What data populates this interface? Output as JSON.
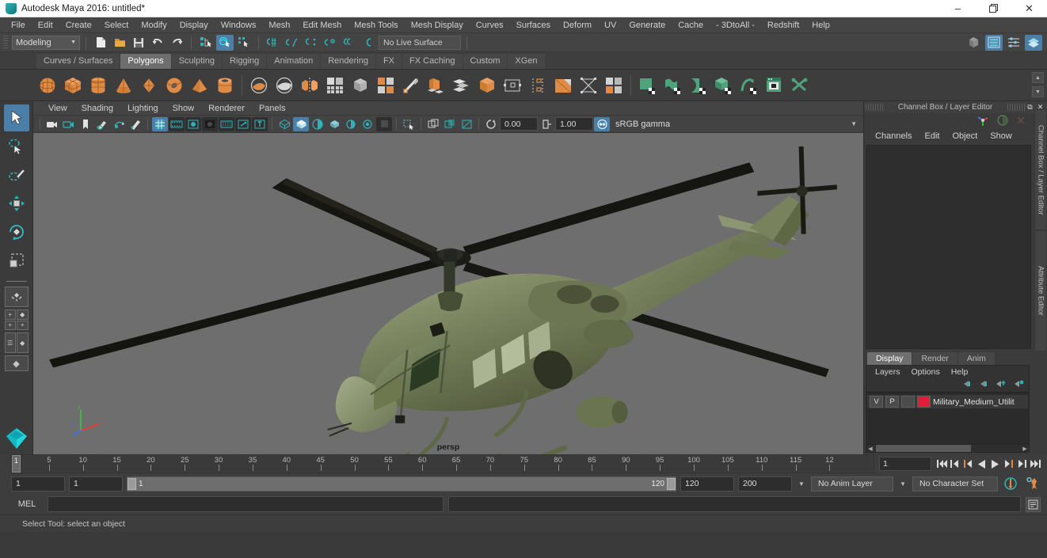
{
  "window": {
    "title": "Autodesk Maya 2016: untitled*",
    "app_icon": "maya-logo-icon",
    "minimize": "–",
    "maximize": "❐",
    "close": "✕"
  },
  "menubar": {
    "items": [
      "File",
      "Edit",
      "Create",
      "Select",
      "Modify",
      "Display",
      "Windows",
      "Mesh",
      "Edit Mesh",
      "Mesh Tools",
      "Mesh Display",
      "Curves",
      "Surfaces",
      "Deform",
      "UV",
      "Generate",
      "Cache",
      "- 3DtoAll -",
      "Redshift",
      "Help"
    ]
  },
  "status_row": {
    "mode_menu": "Modeling",
    "live_surface": "No Live Surface",
    "file_icons": [
      "new-scene-icon",
      "open-scene-icon",
      "save-scene-icon",
      "undo-icon",
      "redo-icon"
    ],
    "select_mask_icons": [
      "select-by-hierarchy-icon",
      "select-by-object-icon",
      "select-by-component-icon"
    ],
    "snap_icons": [
      "snap-to-grid-icon",
      "snap-to-curve-icon",
      "snap-to-point-icon",
      "snap-to-projected-center-icon",
      "snap-to-view-plane-icon",
      "make-live-icon"
    ],
    "right_icons": [
      "show-hide-modeling-toolkit-icon",
      "show-hide-attribute-editor-icon",
      "show-hide-tool-settings-icon",
      "show-hide-channel-box-icon"
    ]
  },
  "shelf": {
    "tabs": [
      "Curves / Surfaces",
      "Polygons",
      "Sculpting",
      "Rigging",
      "Animation",
      "Rendering",
      "FX",
      "FX Caching",
      "Custom",
      "XGen"
    ],
    "active_tab": "Polygons",
    "icons": [
      {
        "name": "poly-sphere-icon",
        "color": "#e08b45",
        "shape": "sphere"
      },
      {
        "name": "poly-cube-icon",
        "color": "#e08b45",
        "shape": "cube"
      },
      {
        "name": "poly-cylinder-icon",
        "color": "#e08b45",
        "shape": "cylinder"
      },
      {
        "name": "poly-cone-icon",
        "color": "#e08b45",
        "shape": "cone"
      },
      {
        "name": "poly-plane-icon",
        "color": "#e08b45",
        "shape": "diamond"
      },
      {
        "name": "poly-torus-icon",
        "color": "#e08b45",
        "shape": "torus"
      },
      {
        "name": "poly-pyramid-icon",
        "color": "#e08b45",
        "shape": "pyramid"
      },
      {
        "name": "poly-pipe-icon",
        "color": "#e08b45",
        "shape": "pipe"
      },
      {
        "name": "poly-booleans-union-icon",
        "color": "#cfcfcf",
        "shape": "bool1"
      },
      {
        "name": "poly-booleans-difference-icon",
        "color": "#cfcfcf",
        "shape": "bool2"
      },
      {
        "name": "poly-mirror-icon",
        "color": "#e08b45",
        "shape": "mirror"
      },
      {
        "name": "poly-smooth-icon",
        "color": "#cfcfcf",
        "shape": "grid"
      },
      {
        "name": "poly-combine-icon",
        "color": "#cfcfcf",
        "shape": "combine"
      },
      {
        "name": "poly-separate-icon",
        "color": "#cfcfcf",
        "shape": "separate"
      },
      {
        "name": "poly-multicut-icon",
        "color": "#cfcfcf",
        "shape": "knife"
      },
      {
        "name": "poly-extrude-icon",
        "color": "#e08b45",
        "shape": "extrude"
      },
      {
        "name": "poly-bevel-icon",
        "color": "#cfcfcf",
        "shape": "layers"
      },
      {
        "name": "poly-bridge-icon",
        "color": "#e08b45",
        "shape": "cubebig"
      },
      {
        "name": "poly-append-icon",
        "color": "#cfcfcf",
        "shape": "quadpts"
      },
      {
        "name": "poly-wedge-icon",
        "color": "#cfcfcf",
        "shape": "wedge"
      },
      {
        "name": "poly-fill-hole-icon",
        "color": "#e08b45",
        "shape": "fill"
      },
      {
        "name": "poly-reduce-icon",
        "color": "#cfcfcf",
        "shape": "reduce"
      },
      {
        "name": "poly-quadrangulate-icon",
        "color": "#cfcfcf",
        "shape": "quads"
      },
      {
        "name": "uv-editor-icon",
        "color": "#5aab85",
        "shape": "uvplane"
      },
      {
        "name": "uv-planar-map-icon",
        "color": "#5aab85",
        "shape": "uvcurve"
      },
      {
        "name": "uv-cylindrical-map-icon",
        "color": "#5aab85",
        "shape": "uvcurve2"
      },
      {
        "name": "uv-automatic-map-icon",
        "color": "#5aab85",
        "shape": "uvcube"
      },
      {
        "name": "uv-unfold-icon",
        "color": "#5aab85",
        "shape": "uvarrow"
      },
      {
        "name": "uv-texture-editor-icon",
        "color": "#5aab85",
        "shape": "uvwin"
      },
      {
        "name": "uv-cut-icon",
        "color": "#5aab85",
        "shape": "uvscissors"
      }
    ]
  },
  "left_toolbar": {
    "tools": [
      {
        "name": "select-tool",
        "active": true
      },
      {
        "name": "lasso-select-tool",
        "active": false
      },
      {
        "name": "paint-select-tool",
        "active": false
      },
      {
        "name": "move-tool",
        "active": false
      },
      {
        "name": "rotate-tool",
        "active": false
      },
      {
        "name": "scale-tool",
        "active": false
      }
    ],
    "layouts": [
      "single-perspective-layout",
      "four-view-layout",
      "outliner-persp-layout",
      "persp-graph-layout",
      "hypershade-layout"
    ]
  },
  "viewport": {
    "menus": [
      "View",
      "Shading",
      "Lighting",
      "Show",
      "Renderer",
      "Panels"
    ],
    "camera_label": "persp",
    "toolbar_left_icons": [
      "select-camera-icon",
      "camera-attributes-icon",
      "bookmark-icon",
      "image-plane-icon",
      "2d-pan-zoom-icon",
      "grease-pencil-icon"
    ],
    "toolbar_display_icons": [
      "grid-toggle-icon",
      "film-gate-icon",
      "resolution-gate-icon",
      "gate-mask-icon",
      "film-origin-icon",
      "exposure-icon",
      "field-chart-icon"
    ],
    "toolbar_shading_icons": [
      "wireframe-icon",
      "smooth-shade-icon",
      "shaded-wireframe-icon",
      "textured-icon",
      "lighting-icon",
      "shadows-icon",
      "ao-icon",
      "aa-icon"
    ],
    "toolbar_xray_icons": [
      "xray-icon",
      "xray-joints-icon",
      "xray-active-components-icon"
    ],
    "exposure_value": "0.00",
    "gamma_value": "1.00",
    "color_management": "sRGB gamma",
    "background_color": "#6e6e6e",
    "model_description": "olive-green military utility helicopter with main rotor and tail rotor"
  },
  "channel_box": {
    "panel_title": "Channel Box / Layer Editor",
    "menus": [
      "Channels",
      "Edit",
      "Object",
      "Show"
    ],
    "side_tabs": [
      "Channel Box / Layer Editor",
      "Attribute Editor"
    ],
    "float_icon": "undock-icon",
    "close_icon": "close-icon",
    "header_icons": [
      "manipulator-icon",
      "sphere-icon",
      "transform-icon"
    ]
  },
  "layer_editor": {
    "tabs": [
      "Display",
      "Render",
      "Anim"
    ],
    "active_tab": "Display",
    "menus": [
      "Layers",
      "Options",
      "Help"
    ],
    "buttons": [
      "layer-move-up-icon",
      "layer-move-down-icon",
      "new-layer-icon",
      "new-layer-from-selected-icon"
    ],
    "layers": [
      {
        "visibility": "V",
        "playback": "P",
        "shading": "",
        "color": "#e01e3c",
        "name": "Military_Medium_Utilit"
      }
    ]
  },
  "timeline": {
    "start_frame": "1",
    "current_frame": "1",
    "ticks": [
      5,
      10,
      15,
      20,
      25,
      30,
      35,
      40,
      45,
      50,
      55,
      60,
      65,
      70,
      75,
      80,
      85,
      90,
      95,
      100,
      105,
      110,
      115
    ],
    "last_label": "12",
    "end_frame": "120",
    "playback_buttons": [
      "go-to-start-icon",
      "step-back-keyframe-icon",
      "step-back-frame-icon",
      "play-backwards-icon",
      "play-forwards-icon",
      "step-forward-frame-icon",
      "step-forward-keyframe-icon",
      "go-to-end-icon"
    ]
  },
  "range_slider": {
    "anim_start": "1",
    "range_start": "1",
    "range_bar_left": "1",
    "range_bar_right": "120",
    "range_end": "120",
    "anim_end": "200",
    "anim_layer": "No Anim Layer",
    "character_set": "No Character Set",
    "auto_key_icon": "auto-keyframe-icon",
    "anim_prefs_icon": "animation-preferences-icon"
  },
  "command_line": {
    "language": "MEL",
    "input_value": "",
    "output_value": "",
    "script_editor_icon": "script-editor-icon"
  },
  "status_bar": {
    "help_text": "Select Tool: select an object"
  },
  "colors": {
    "accent_blue": "#4b7fa8",
    "shelf_orange": "#e08b45",
    "shelf_green": "#5aab85",
    "layer_red": "#e01e3c",
    "viewport_bg": "#6e6e6e"
  }
}
